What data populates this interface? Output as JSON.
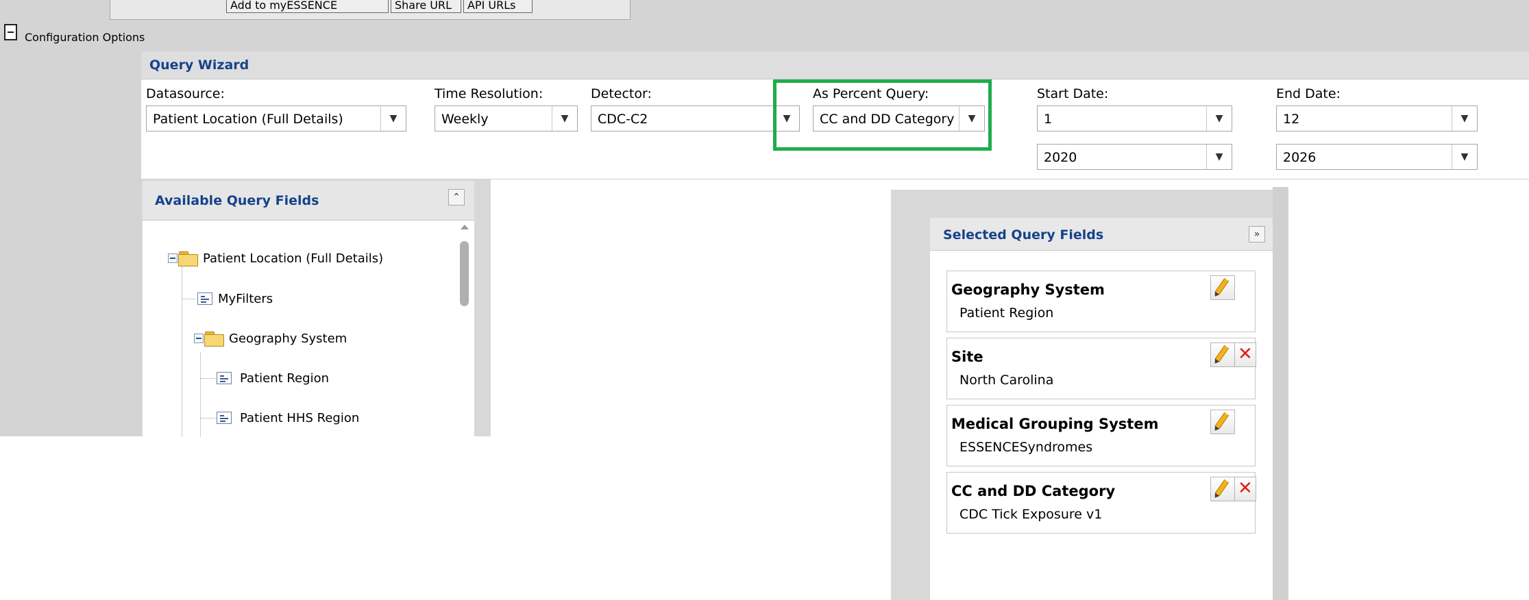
{
  "top_toolbar": {
    "buttons": [
      "Add to myESSENCE",
      "Share URL",
      "API URLs"
    ]
  },
  "config_options": {
    "label": "Configuration Options"
  },
  "query_wizard": {
    "title": "Query Wizard",
    "datasource": {
      "label": "Datasource:",
      "value": "Patient Location (Full Details)"
    },
    "time_resolution": {
      "label": "Time Resolution:",
      "value": "Weekly"
    },
    "detector": {
      "label": "Detector:",
      "value": "CDC-C2"
    },
    "as_percent_query": {
      "label": "As Percent Query:",
      "value": "CC and DD Category"
    },
    "start_date": {
      "label": "Start Date:",
      "month": "1",
      "year": "2020"
    },
    "end_date": {
      "label": "End Date:",
      "month": "12",
      "year": "2026"
    }
  },
  "available_fields": {
    "title": "Available Query Fields",
    "tree": [
      "Patient Location (Full Details)",
      "MyFilters",
      "Geography System",
      "Patient Region",
      "Patient HHS Region"
    ]
  },
  "selected_fields": {
    "title": "Selected Query Fields",
    "cards": [
      {
        "title": "Geography System",
        "value": "Patient Region"
      },
      {
        "title": "Site",
        "value": "North Carolina"
      },
      {
        "title": "Medical Grouping System",
        "value": "ESSENCESyndromes"
      },
      {
        "title": "CC and DD Category",
        "value": "CDC Tick Exposure v1"
      }
    ]
  },
  "colors": {
    "highlight": "#1fac4b",
    "panel_title": "#15428b",
    "delete_icon": "#e0201a"
  }
}
